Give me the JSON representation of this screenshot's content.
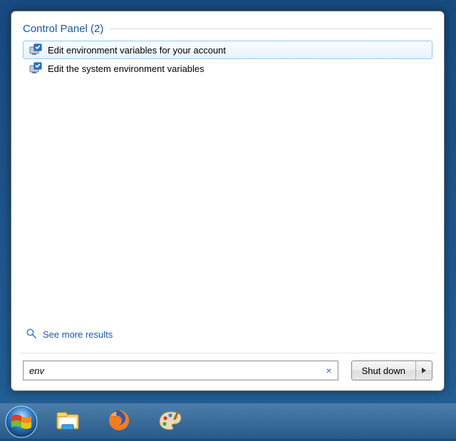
{
  "section": {
    "title": "Control Panel (2)"
  },
  "results": [
    {
      "label": "Edit environment variables for your account"
    },
    {
      "label": "Edit the system environment variables"
    }
  ],
  "see_more": "See more results",
  "search": {
    "value": "env"
  },
  "shutdown": {
    "label": "Shut down"
  }
}
